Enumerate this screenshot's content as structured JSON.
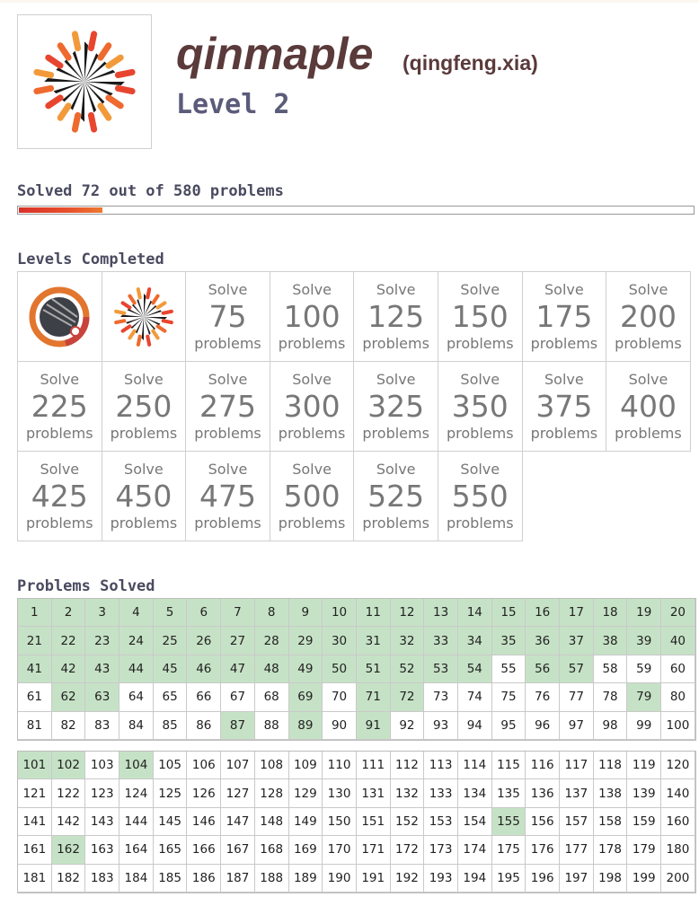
{
  "profile": {
    "username": "qinmaple",
    "real_name": "(qingfeng.xia)",
    "level_label": "Level 2",
    "avatar_icon": "sunburst-diamond-icon"
  },
  "progress": {
    "text": "Solved 72 out of 580 problems",
    "solved": 72,
    "total": 580
  },
  "levels": {
    "heading": "Levels Completed",
    "badges": [
      {
        "icon": "ring-badge-icon"
      },
      {
        "icon": "sunburst-diamond-icon"
      }
    ],
    "tiles": [
      {
        "top": "Solve",
        "num": "75",
        "bottom": "problems"
      },
      {
        "top": "Solve",
        "num": "100",
        "bottom": "problems"
      },
      {
        "top": "Solve",
        "num": "125",
        "bottom": "problems"
      },
      {
        "top": "Solve",
        "num": "150",
        "bottom": "problems"
      },
      {
        "top": "Solve",
        "num": "175",
        "bottom": "problems"
      },
      {
        "top": "Solve",
        "num": "200",
        "bottom": "problems"
      },
      {
        "top": "Solve",
        "num": "225",
        "bottom": "problems"
      },
      {
        "top": "Solve",
        "num": "250",
        "bottom": "problems"
      },
      {
        "top": "Solve",
        "num": "275",
        "bottom": "problems"
      },
      {
        "top": "Solve",
        "num": "300",
        "bottom": "problems"
      },
      {
        "top": "Solve",
        "num": "325",
        "bottom": "problems"
      },
      {
        "top": "Solve",
        "num": "350",
        "bottom": "problems"
      },
      {
        "top": "Solve",
        "num": "375",
        "bottom": "problems"
      },
      {
        "top": "Solve",
        "num": "400",
        "bottom": "problems"
      },
      {
        "top": "Solve",
        "num": "425",
        "bottom": "problems"
      },
      {
        "top": "Solve",
        "num": "450",
        "bottom": "problems"
      },
      {
        "top": "Solve",
        "num": "475",
        "bottom": "problems"
      },
      {
        "top": "Solve",
        "num": "500",
        "bottom": "problems"
      },
      {
        "top": "Solve",
        "num": "525",
        "bottom": "problems"
      },
      {
        "top": "Solve",
        "num": "550",
        "bottom": "problems"
      }
    ]
  },
  "problems": {
    "heading": "Problems Solved",
    "blocks": [
      {
        "start": 1,
        "end": 100
      },
      {
        "start": 101,
        "end": 200
      }
    ],
    "solved": [
      1,
      2,
      3,
      4,
      5,
      6,
      7,
      8,
      9,
      10,
      11,
      12,
      13,
      14,
      15,
      16,
      17,
      18,
      19,
      20,
      21,
      22,
      23,
      24,
      25,
      26,
      27,
      28,
      29,
      30,
      31,
      32,
      33,
      34,
      35,
      36,
      37,
      38,
      39,
      40,
      41,
      42,
      43,
      44,
      45,
      46,
      47,
      48,
      49,
      50,
      51,
      52,
      53,
      54,
      56,
      57,
      62,
      63,
      69,
      71,
      72,
      79,
      87,
      89,
      91,
      101,
      102,
      104,
      155,
      162
    ],
    "solved_color": "#c6e2c6"
  },
  "colors": {
    "accent_title": "#5a3a3a",
    "level_text": "#5b5b7a",
    "progress_fill": "#d8322a"
  }
}
